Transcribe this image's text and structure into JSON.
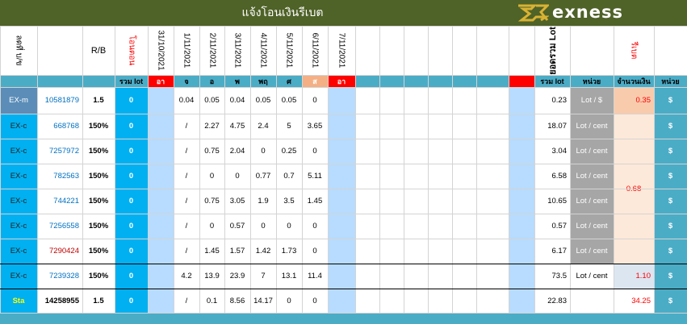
{
  "banner": {
    "title": "แจ้งโอนเงินรีเบต",
    "logo_text": "exness"
  },
  "header": {
    "customer_col": "ลดที่ บ/ข",
    "rb_col": "R/B",
    "transfer_col": "โอนตอน",
    "total_lot_col": "ยอดรวม Lot",
    "rebate_col": "รีเบต",
    "dates": [
      "31/10/2021",
      "1/11/2021",
      "2/11/2021",
      "3/11/2021",
      "4/11/2021",
      "5/11/2021",
      "6/11/2021",
      "7/11/2021"
    ]
  },
  "subheader": {
    "sum_lot": "รวม lot",
    "days": [
      "อา",
      "จ",
      "อ",
      "พ",
      "พฤ",
      "ศ",
      "ส",
      "อา"
    ],
    "sum_lot2": "รวม lot",
    "unit": "หน่วย",
    "amount": "จำนวนเงิน",
    "unit2": "หน่วย"
  },
  "rows": [
    {
      "type": "EX-m",
      "acct": "10581879",
      "rb": "1.5",
      "zero": "0",
      "vals": [
        "0.04",
        "0.05",
        "0.04",
        "0.05",
        "0.05",
        "0"
      ],
      "total": "0.23",
      "unit": "Lot / $",
      "amount": "0.35",
      "cur": "$"
    },
    {
      "type": "EX-c",
      "acct": "668768",
      "rb": "150%",
      "zero": "0",
      "vals": [
        "/",
        "2.27",
        "4.75",
        "2.4",
        "5",
        "3.65"
      ],
      "total": "18.07",
      "unit": "Lot / cent",
      "amount": "",
      "cur": "$"
    },
    {
      "type": "EX-c",
      "acct": "7257972",
      "rb": "150%",
      "zero": "0",
      "vals": [
        "/",
        "0.75",
        "2.04",
        "0",
        "0.25",
        "0"
      ],
      "total": "3.04",
      "unit": "Lot / cent",
      "amount": "",
      "cur": "$"
    },
    {
      "type": "EX-c",
      "acct": "782563",
      "rb": "150%",
      "zero": "0",
      "vals": [
        "/",
        "0",
        "0",
        "0.77",
        "0.7",
        "5.11"
      ],
      "total": "6.58",
      "unit": "Lot / cent",
      "amount": "",
      "cur": "$"
    },
    {
      "type": "EX-c",
      "acct": "744221",
      "rb": "150%",
      "zero": "0",
      "vals": [
        "/",
        "0.75",
        "3.05",
        "1.9",
        "3.5",
        "1.45"
      ],
      "total": "10.65",
      "unit": "Lot / cent",
      "amount": "",
      "cur": "$"
    },
    {
      "type": "EX-c",
      "acct": "7256558",
      "rb": "150%",
      "zero": "0",
      "vals": [
        "/",
        "0",
        "0.57",
        "0",
        "0",
        "0"
      ],
      "total": "0.57",
      "unit": "Lot / cent",
      "amount": "",
      "cur": "$"
    },
    {
      "type": "EX-c",
      "acct": "7290424",
      "rb": "150%",
      "zero": "0",
      "vals": [
        "/",
        "1.45",
        "1.57",
        "1.42",
        "1.73",
        "0"
      ],
      "total": "6.17",
      "unit": "Lot / cent",
      "amount": "",
      "cur": "$"
    },
    {
      "type": "EX-c",
      "acct": "7239328",
      "rb": "150%",
      "zero": "0",
      "vals": [
        "4.2",
        "13.9",
        "23.9",
        "7",
        "13.1",
        "11.4"
      ],
      "total": "73.5",
      "unit": "Lot / cent",
      "amount": "1.10",
      "cur": "$"
    },
    {
      "type": "Sta",
      "acct": "14258955",
      "rb": "1.5",
      "zero": "0",
      "vals": [
        "/",
        "0.1",
        "8.56",
        "14.17",
        "0",
        "0"
      ],
      "total": "22.83",
      "unit": "Lot / $",
      "amount": "34.25",
      "cur": "$"
    }
  ],
  "merged_amount": "0.68",
  "colors": {
    "banner": "#4f6228",
    "teal": "#4bacc6",
    "cyan": "#00b0f0",
    "red": "#ff0000",
    "gray": "#a6a6a6",
    "peach": "#fde9d9",
    "lightblue": "#b7dcff",
    "orange": "#f4b084"
  }
}
